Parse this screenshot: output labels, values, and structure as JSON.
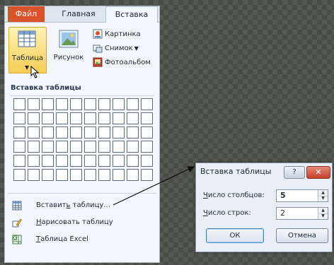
{
  "ribbon": {
    "tabs": {
      "file": "Файл",
      "home": "Главная",
      "insert": "Вставка"
    },
    "table_button": "Таблица",
    "picture_button": "Рисунок",
    "clipart_button": "Картинка",
    "snapshot_button": "Снимок",
    "album_button": "Фотоальбом",
    "active_tab_accent": "#d9532b",
    "highlight_color": "#f7cd55"
  },
  "dropdown": {
    "grid_header": "Вставка таблицы",
    "grid_columns": 10,
    "grid_rows": 6,
    "menu": [
      {
        "label_pre": "Вставит",
        "label_u": "ь",
        "label_post": " таблицу...",
        "icon": "insert-table-icon"
      },
      {
        "label_pre": "",
        "label_u": "Н",
        "label_post": "арисовать таблицу",
        "icon": "draw-table-pencil-icon"
      },
      {
        "label_pre": "",
        "label_u": "Т",
        "label_post": "аблица Excel",
        "icon": "excel-table-icon"
      }
    ]
  },
  "dialog": {
    "title": "Вставка таблицы",
    "help": "?",
    "close": "✕",
    "cols_label_u": "Ч",
    "cols_label_rest": "исло столбцов:",
    "cols_value": "5",
    "rows_label_u": "Ч",
    "rows_label_rest": "исло строк:",
    "rows_value": "2",
    "ok": "ОК",
    "cancel": "Отмена"
  }
}
